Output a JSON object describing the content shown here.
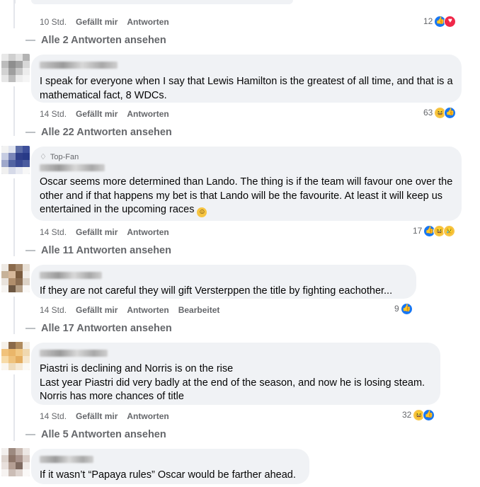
{
  "top_comment_meta": {
    "time": "10 Std.",
    "like": "Gefällt mir",
    "reply": "Antworten",
    "count": "12"
  },
  "top_view_replies": "Alle 2 Antworten ansehen",
  "comments": [
    {
      "text": "I speak for everyone when I say that Lewis Hamilton is the greatest of all time, and that is a mathematical fact, 8 WDCs.",
      "time": "14 Std.",
      "like": "Gefällt mir",
      "reply": "Antworten",
      "reaction_count": "63",
      "reactions": [
        "haha",
        "like"
      ],
      "view_replies": "Alle 22 Antworten ansehen"
    },
    {
      "badge": "Top-Fan",
      "text": "Oscar seems more determined than Lando. The thing is if the team will favour one over the other and if that happens my bet is that Lando will be the favourite. At least it will keep us entertained in the upcoming races",
      "time": "14 Std.",
      "like": "Gefällt mir",
      "reply": "Antworten",
      "reaction_count": "17",
      "reactions": [
        "like",
        "haha",
        "sad"
      ],
      "view_replies": "Alle 11 Antworten ansehen"
    },
    {
      "text": "If they are not careful they will gift Versterppen the title by fighting eachother...",
      "time": "14 Std.",
      "like": "Gefällt mir",
      "reply": "Antworten",
      "edited": "Bearbeitet",
      "reaction_count": "9",
      "reactions": [
        "like"
      ],
      "view_replies": "Alle 17 Antworten ansehen"
    },
    {
      "text_lines": [
        "Piastri is declining and Norris is on the rise",
        "Last year Piastri did very badly at the end of the season, and now he is losing steam.",
        "Norris has more chances of title"
      ],
      "time": "14 Std.",
      "like": "Gefällt mir",
      "reply": "Antworten",
      "reaction_count": "32",
      "reactions": [
        "haha",
        "like"
      ],
      "view_replies": "Alle 5 Antworten ansehen"
    },
    {
      "text": "If it wasn’t “Papaya rules” Oscar would be farther ahead."
    }
  ],
  "colors": {
    "like": "#1877f2",
    "love": "#f02849",
    "haha": "#f7c542",
    "bubble": "#f0f2f5",
    "meta": "#65676b"
  }
}
